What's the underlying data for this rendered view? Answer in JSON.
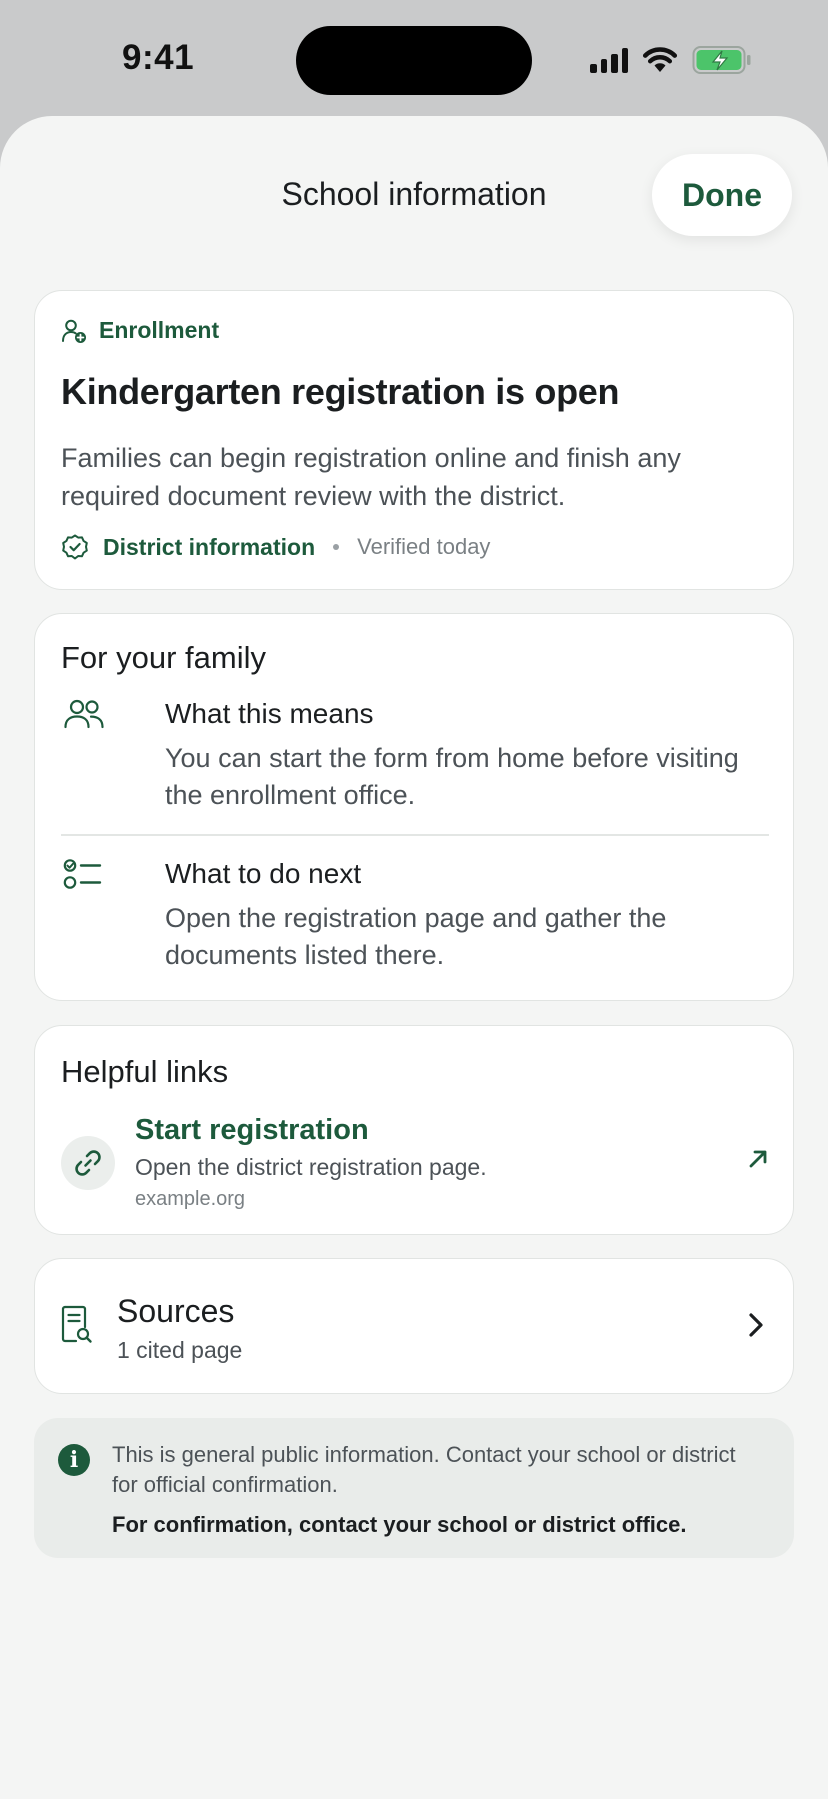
{
  "status_bar": {
    "time": "9:41",
    "icons": [
      "cellular-signal-icon",
      "wifi-icon",
      "battery-charging-icon"
    ]
  },
  "sheet": {
    "title": "School information",
    "done_label": "Done"
  },
  "enrollment_card": {
    "tag": "Enrollment",
    "tag_icon": "person-add-icon",
    "title": "Kindergarten registration is open",
    "body": "Families can begin registration online and finish any required document review with the district.",
    "source_label": "District information",
    "source_icon": "verified-badge-icon",
    "verified": "Verified today"
  },
  "family_card": {
    "heading": "For your family",
    "items": [
      {
        "icon": "people-icon",
        "title": "What this means",
        "body": "You can start the form from home before visiting the enrollment office."
      },
      {
        "icon": "checklist-icon",
        "title": "What to do next",
        "body": "Open the registration page and gather the documents listed there."
      }
    ]
  },
  "links_card": {
    "heading": "Helpful links",
    "link": {
      "icon": "link-icon",
      "title": "Start registration",
      "description": "Open the district registration page.",
      "domain": "example.org",
      "action_icon": "external-arrow-icon"
    }
  },
  "sources_card": {
    "icon": "document-search-icon",
    "title": "Sources",
    "subtitle": "1 cited page",
    "action_icon": "chevron-right-icon"
  },
  "notice": {
    "icon": "info-icon",
    "icon_glyph": "i",
    "text": "This is general public information. Contact your school or district for official confirmation.",
    "strong": "For confirmation, contact your school or district office."
  },
  "colors": {
    "accent": "#1d5a3c",
    "sheet_background": "#f4f5f4",
    "card_background": "#ffffff",
    "battery_fill": "#4cc46a"
  }
}
